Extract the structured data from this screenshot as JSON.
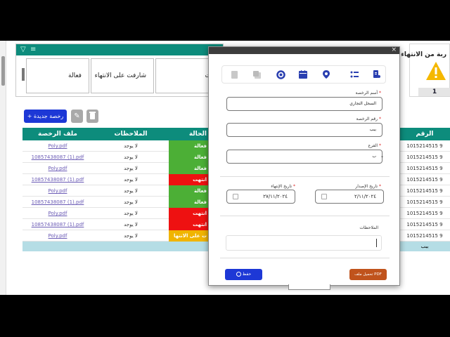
{
  "filter_card": {
    "statuses": [
      {
        "label": "فعالة"
      },
      {
        "label": "شارفت على الانتهاء"
      },
      {
        "label": "ت"
      }
    ]
  },
  "warning_card": {
    "title": "ربة من الانتهاء",
    "count": "1"
  },
  "toolbar": {
    "new_label": "+ رخصة جديدة",
    "edit_icon": "pencil-icon",
    "delete_icon": "trash-icon"
  },
  "table": {
    "headers": {
      "file": "ملف الرخصة",
      "notes": "الملاحظات",
      "status": "الحالة",
      "number": "الرقم"
    },
    "rows": [
      {
        "file": "Poly.pdf",
        "notes": "لا يوجد",
        "status": "فعالة",
        "status_color": "#4caf36",
        "number": "1015214515 9"
      },
      {
        "file": "10857438087 (1).pdf",
        "notes": "لا يوجد",
        "status": "فعالة",
        "status_color": "#4caf36",
        "number": "1015214515 9"
      },
      {
        "file": "Poly.pdf",
        "notes": "لا يوجد",
        "status": "فعالة",
        "status_color": "#4caf36",
        "number": "1015214515 9"
      },
      {
        "file": "10857438087 (1).pdf",
        "notes": "لا يوجد",
        "status": "انتهت",
        "status_color": "#ee1111",
        "number": "1015214515 9"
      },
      {
        "file": "Poly.pdf",
        "notes": "لا يوجد",
        "status": "فعالة",
        "status_color": "#4caf36",
        "number": "1015214515 9"
      },
      {
        "file": "10857438087 (1).pdf",
        "notes": "لا يوجد",
        "status": "فعالة",
        "status_color": "#4caf36",
        "number": "1015214515 9"
      },
      {
        "file": "Poly.pdf",
        "notes": "لا يوجد",
        "status": "انتهت",
        "status_color": "#ee1111",
        "number": "1015214515 9"
      },
      {
        "file": "10857438087 (1).pdf",
        "notes": "لا يوجد",
        "status": "انتهت",
        "status_color": "#ee1111",
        "number": "1015214515 9"
      },
      {
        "file": "Poly.pdf",
        "notes": "لا يوجد",
        "status": "ت على الانتها",
        "status_color": "#f0b400",
        "number": "1015214515 9"
      }
    ],
    "footer_value": "ببب"
  },
  "modal": {
    "close": "×",
    "icons": [
      "license-icon",
      "list-icon",
      "location-pin-icon",
      "calendar-icon",
      "progress-icon",
      "copy-icon",
      "document-icon"
    ],
    "license_name": {
      "label": "أسم الرخصة",
      "value": "السجل التجاري"
    },
    "license_number": {
      "label": "رقم الرخصة",
      "value": "ببب"
    },
    "branch": {
      "label": "الفرع",
      "value": "ب"
    },
    "issue_date": {
      "label": "تاريخ الإصدار",
      "value": "٢/١١/٢٠٢٤"
    },
    "expiry_date": {
      "label": "تاريخ الإنتهاء",
      "value": "٢٧/١١/٢٠٢٤"
    },
    "notes": {
      "label": "الملاحظات",
      "value": ""
    },
    "save_label": "حفظ",
    "upload_label": "تحميل ملف PDF"
  },
  "colors": {
    "teal": "#0d8c7c",
    "blue": "#1d38d6",
    "orange": "#c0531c",
    "green": "#4caf36",
    "red": "#ee1111",
    "yellow": "#f0b400"
  }
}
